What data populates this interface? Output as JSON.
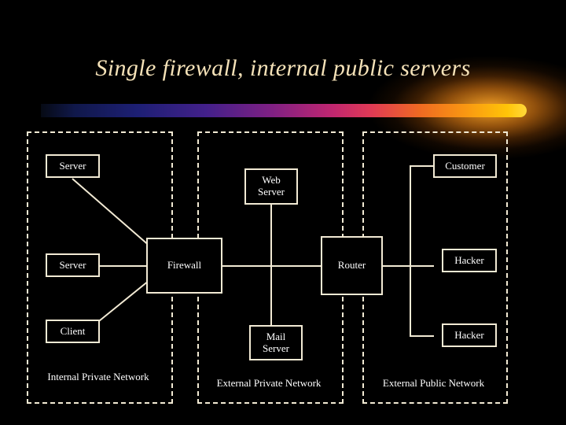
{
  "slide": {
    "title": "Single firewall, internal public servers",
    "background_color": "#000000",
    "title_color": "#f5e2b8",
    "line_color": "#f2ead4"
  },
  "zones": [
    {
      "id": "internal-private",
      "label": "Internal Private Network"
    },
    {
      "id": "external-private",
      "label": "External  Private Network"
    },
    {
      "id": "external-public",
      "label": "External Public Network"
    }
  ],
  "nodes": {
    "server_top": "Server",
    "server_mid": "Server",
    "client": "Client",
    "firewall": "Firewall",
    "web_server_line1": "Web",
    "web_server_line2": "Server",
    "mail_server_line1": "Mail",
    "mail_server_line2": "Server",
    "router": "Router",
    "customer": "Customer",
    "hacker_top": "Hacker",
    "hacker_bottom": "Hacker"
  }
}
